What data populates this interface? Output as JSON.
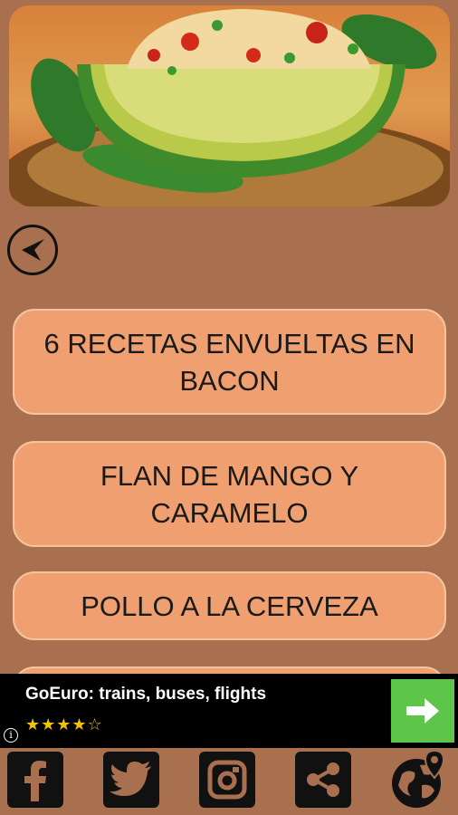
{
  "recipes": [
    "6 RECETAS ENVUELTAS EN BACON",
    "FLAN DE MANGO Y CARAMELO",
    "POLLO A LA CERVEZA",
    ""
  ],
  "ad": {
    "title": "GoEuro: trains, buses, flights",
    "rating": 4.5,
    "stars": "★★★★☆",
    "info": "i"
  },
  "social": [
    "facebook-icon",
    "twitter-icon",
    "instagram-icon",
    "share-icon",
    "globe-location-icon"
  ],
  "colors": {
    "background": "#a8704f",
    "button": "#f0a070",
    "ad_action": "#5cc54a",
    "stars": "#f2c300"
  }
}
